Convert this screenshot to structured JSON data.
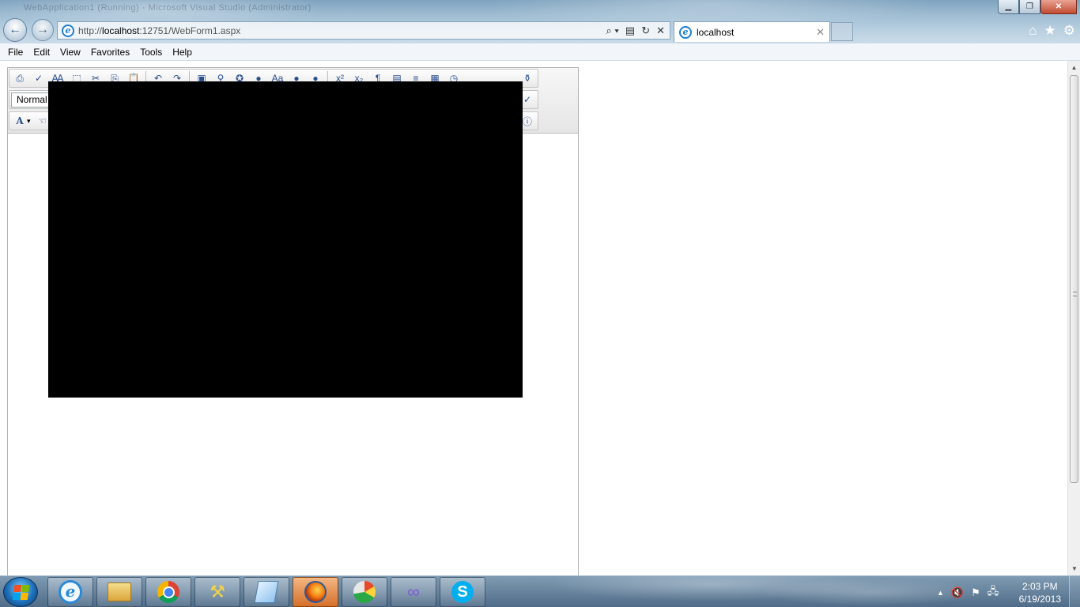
{
  "window": {
    "title": "WebApplication1 (Running) - Microsoft Visual Studio (Administrator)",
    "minimize_glyph": "▁",
    "restore_glyph": "❐",
    "close_glyph": "✕"
  },
  "browser": {
    "url_prefix": "http://",
    "url_host": "localhost",
    "url_rest": ":12751/WebForm1.aspx",
    "search_glyph": "⌕ ▾",
    "compat_glyph": "▤",
    "refresh_glyph": "↻",
    "stop_glyph": "✕",
    "back_glyph": "←",
    "forward_glyph": "→",
    "tab_label": "localhost",
    "tab_close_glyph": "✕",
    "home_glyph": "⌂",
    "favorites_glyph": "★",
    "tools_glyph": "⚙"
  },
  "menubar": {
    "items": [
      "File",
      "Edit",
      "View",
      "Favorites",
      "Tools",
      "Help"
    ]
  },
  "editor": {
    "format_select_value": "Normal",
    "toolbar_row1_icons": [
      "print-icon",
      "spellcheck-icon",
      "find-icon",
      "select-all-icon",
      "cut-icon",
      "copy-icon",
      "paste-icon",
      "paste-dropdown-icon",
      "undo-icon",
      "redo-icon",
      "image-icon",
      "link-icon",
      "flash-icon",
      "media-icon",
      "text-icon",
      "globe-icon",
      "unlink-icon",
      "superscript-icon",
      "subscript-icon",
      "paragraph-icon",
      "template-icon",
      "horizontal-rule-icon",
      "form-icon",
      "clock-icon",
      "clean-icon"
    ],
    "toolbar_row3_first": "A",
    "row1_glyphs": [
      "⎙",
      "✓",
      "Ꜳ",
      "⬚",
      "✂",
      "⎘",
      "📋",
      "↶",
      "↷",
      "▣",
      "⚲",
      "✪",
      "●",
      "Aa",
      "●",
      "●",
      "x²",
      "x₂",
      "¶",
      "▤",
      "≡",
      "▦",
      "◷",
      "⚱"
    ],
    "w3c_glyph": "✓",
    "info_glyph": "ⓘ",
    "font_dropdown_glyph": "▾",
    "hand_glyph": "☜"
  },
  "scrollbar": {
    "up_glyph": "▲",
    "down_glyph": "▼"
  },
  "taskbar": {
    "apps": [
      "Internet Explorer",
      "Windows Explorer",
      "Google Chrome",
      "Tools",
      "Document",
      "Firefox",
      "App",
      "Visual Studio",
      "Skype"
    ],
    "ie_glyph": "e",
    "tools_glyph": "⚒",
    "vs_glyph": "∞",
    "skype_glyph": "S",
    "tray_icons": [
      "▲",
      "🔇",
      "⚑",
      "🖧"
    ],
    "time": "2:03 PM",
    "date": "6/19/2013"
  },
  "colors": {
    "win_logo": [
      "#f25022",
      "#7fba00",
      "#00a4ef",
      "#ffb900"
    ]
  }
}
